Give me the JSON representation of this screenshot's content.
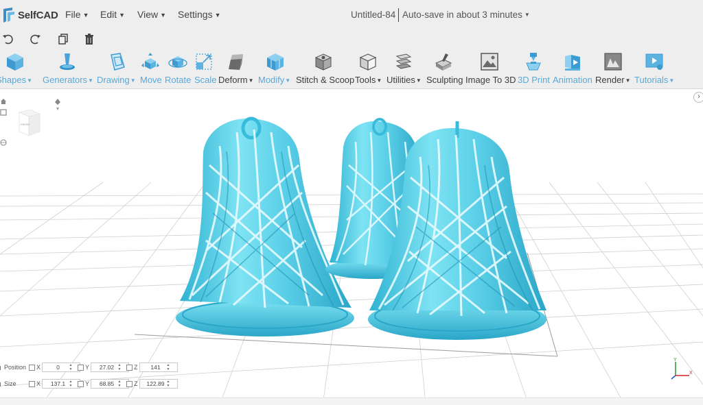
{
  "app": {
    "name": "SelfCAD"
  },
  "menus": [
    {
      "label": "File"
    },
    {
      "label": "Edit"
    },
    {
      "label": "View"
    },
    {
      "label": "Settings"
    }
  ],
  "document": {
    "title": "Untitled-84",
    "autosave": "Auto-save in about 3 minutes"
  },
  "quick_actions": [
    {
      "icon": "undo-icon"
    },
    {
      "icon": "redo-icon"
    },
    {
      "icon": "copy-icon"
    },
    {
      "icon": "trash-icon"
    }
  ],
  "ribbon": [
    {
      "label": "Shapes",
      "dropdown": true
    },
    {
      "label": "Generators",
      "dropdown": true
    },
    {
      "label": "Drawing",
      "dropdown": true
    },
    {
      "label": "Move",
      "dropdown": false
    },
    {
      "label": "Rotate",
      "dropdown": false
    },
    {
      "label": "Scale",
      "dropdown": false
    },
    {
      "label": "Deform",
      "dropdown": true
    },
    {
      "label": "Modify",
      "dropdown": true
    },
    {
      "label": "Stitch & Scoop",
      "dropdown": false
    },
    {
      "label": "Tools",
      "dropdown": true
    },
    {
      "label": "Utilities",
      "dropdown": true
    },
    {
      "label": "Sculpting",
      "dropdown": false
    },
    {
      "label": "Image To 3D",
      "dropdown": false
    },
    {
      "label": "3D Print",
      "dropdown": false
    },
    {
      "label": "Animation",
      "dropdown": false
    },
    {
      "label": "Render",
      "dropdown": true
    },
    {
      "label": "Tutorials",
      "dropdown": true
    }
  ],
  "navcube": {
    "face_label": "FRONT"
  },
  "transform": {
    "position": {
      "label": "Position",
      "x": "0",
      "y": "27.02",
      "z": "141"
    },
    "size": {
      "label": "Size",
      "x": "137.1",
      "y": "68.85",
      "z": "122.89"
    },
    "axis_labels": {
      "x": "X",
      "y": "Y",
      "z": "Z"
    }
  },
  "gizmo": {
    "y": "Y",
    "x": "X"
  },
  "colors": {
    "model": "#5cd0e8",
    "model_dark": "#2eaccc",
    "accent_blue": "#5aa9d6",
    "toolbar_bg": "#eeeeee"
  }
}
